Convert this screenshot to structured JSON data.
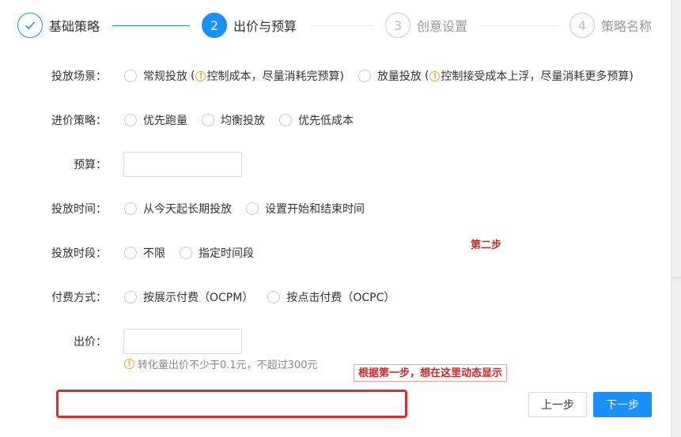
{
  "steps": [
    {
      "number": "",
      "label": "基础策略",
      "state": "done"
    },
    {
      "number": "2",
      "label": "出价与预算",
      "state": "active"
    },
    {
      "number": "3",
      "label": "创意设置",
      "state": "wait"
    },
    {
      "number": "4",
      "label": "策略名称",
      "state": "wait"
    }
  ],
  "form": {
    "scene": {
      "label": "投放场景：",
      "opt1": "常规投放",
      "opt1_note_open": "(",
      "opt1_note": "控制成本，尽量消耗完预算)",
      "opt2": "放量投放",
      "opt2_note_open": "(",
      "opt2_note": "控制接受成本上浮，尽量消耗更多预算)"
    },
    "strategy": {
      "label": "进价策略：",
      "options": [
        "优先跑量",
        "均衡投放",
        "优先低成本"
      ]
    },
    "budget": {
      "label": "预算：",
      "value": ""
    },
    "time": {
      "label": "投放时间：",
      "options": [
        "从今天起长期投放",
        "设置开始和结束时间"
      ]
    },
    "period": {
      "label": "投放时段：",
      "options": [
        "不限",
        "指定时间段"
      ]
    },
    "pay": {
      "label": "付费方式：",
      "options": [
        "按展示付费（OCPM）",
        "按点击付费（OCPC）"
      ]
    },
    "bid": {
      "label": "出价：",
      "value": "",
      "hint": "转化量出价不少于0.1元，不超过300元"
    }
  },
  "annotations": {
    "step2": "第二步",
    "dynamic": "根据第一步，想在这里动态显示"
  },
  "buttons": {
    "prev": "上一步",
    "next": "下一步"
  },
  "colors": {
    "primary": "#1890ff",
    "warning": "#f5a623",
    "annotation": "#e02020"
  }
}
